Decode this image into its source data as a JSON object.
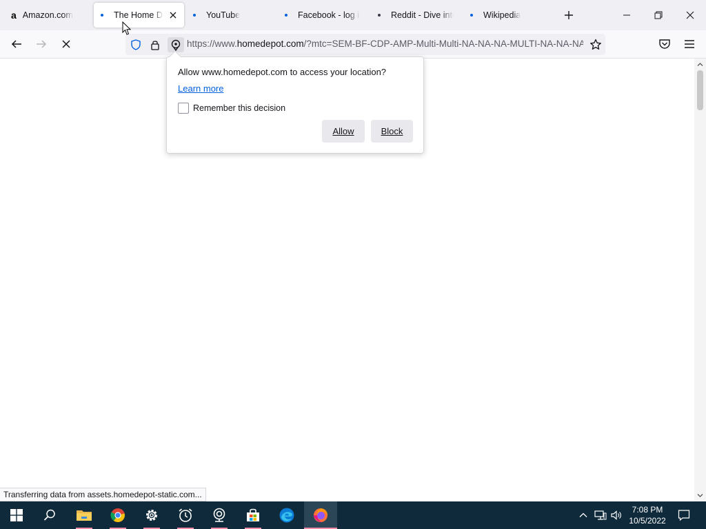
{
  "tabs": [
    {
      "label": "Amazon.com",
      "favicon": "a",
      "active": false
    },
    {
      "label": "The Home Depot",
      "active": true,
      "close_icon": "close-icon"
    },
    {
      "label": "YouTube",
      "active": false
    },
    {
      "label": "Facebook - log in or sign up",
      "active": false
    },
    {
      "label": "Reddit - Dive into anything",
      "active": false
    },
    {
      "label": "Wikipedia",
      "active": false
    }
  ],
  "window_controls": [
    "minimize-icon",
    "restore-icon",
    "close-icon"
  ],
  "url": {
    "scheme": "https://www.",
    "host": "homedepot.com",
    "path": "/?mtc=SEM-BF-CDP-AMP-Multi-Multi-NA-NA-NA-MULTI-NA-NA-NA-NA"
  },
  "permission_popup": {
    "title": "Allow www.homedepot.com to access your location?",
    "learn_more": "Learn more",
    "remember_label": "Remember this decision",
    "remember_checked": false,
    "allow_label": "Allow",
    "block_label": "Block"
  },
  "status_bar": "Transferring data from assets.homedepot-static.com...",
  "taskbar": {
    "apps": [
      "start-icon",
      "search-icon",
      "file-explorer-icon",
      "chrome-icon",
      "settings-icon",
      "alarms-clock-icon",
      "webcam-icon",
      "store-icon",
      "edge-icon",
      "firefox-icon"
    ],
    "time": "7:08 PM",
    "date": "10/5/2022"
  },
  "colors": {
    "accent": "#0060df",
    "taskbar": "#0f2a3b",
    "running_indicator": "#f08da8"
  }
}
